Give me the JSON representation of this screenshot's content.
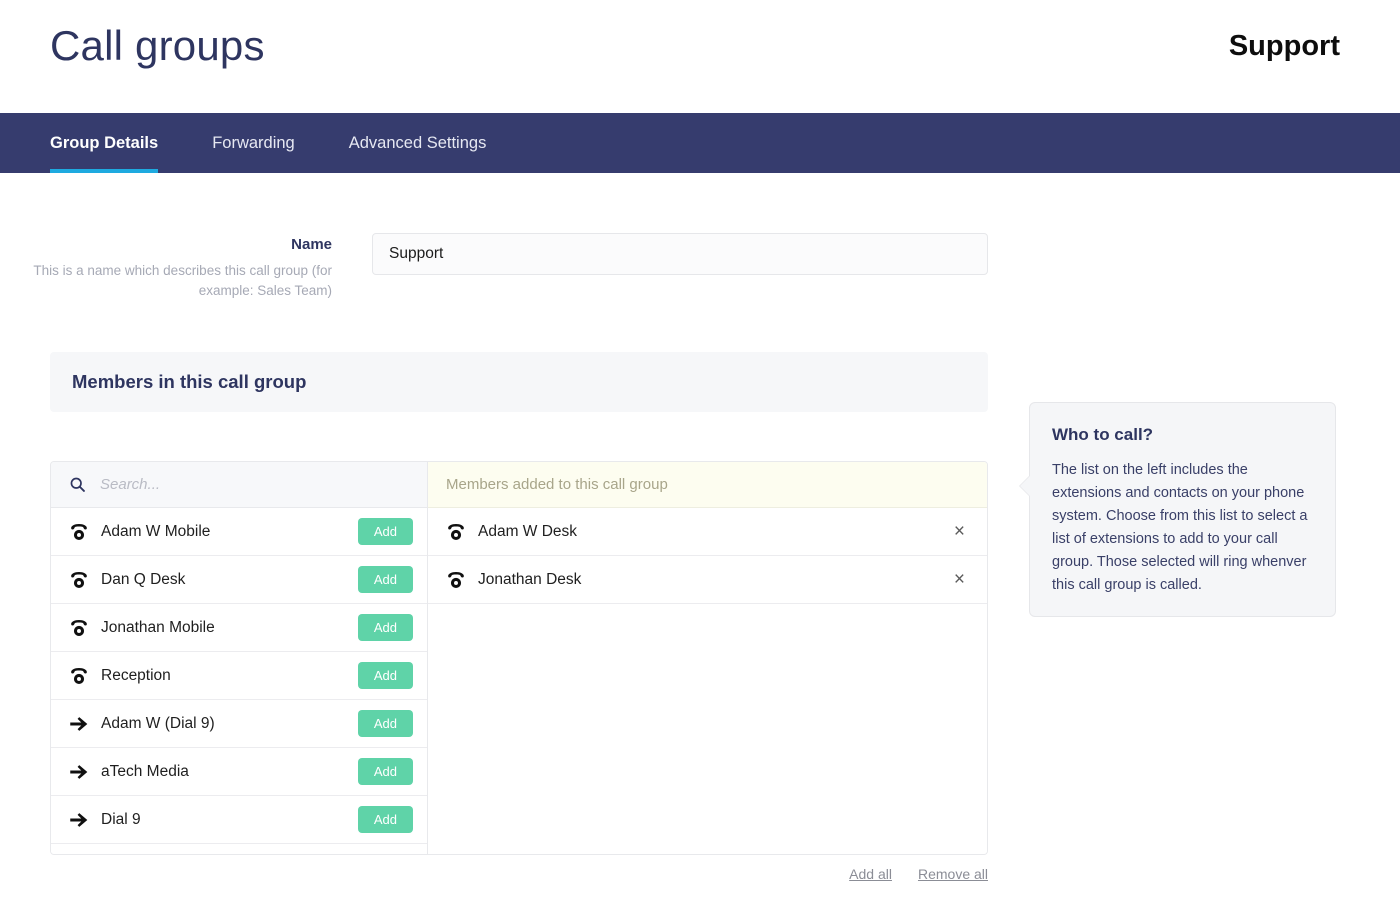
{
  "header": {
    "page_title": "Call groups",
    "account_title": "Support"
  },
  "nav": {
    "tabs": [
      {
        "label": "Group Details",
        "active": true
      },
      {
        "label": "Forwarding",
        "active": false
      },
      {
        "label": "Advanced Settings",
        "active": false
      }
    ]
  },
  "form": {
    "name_label": "Name",
    "name_help": "This is a name which describes this call group (for example: Sales Team)",
    "name_value": "Support",
    "name_placeholder": ""
  },
  "members_panel": {
    "title": "Members in this call group"
  },
  "dual_list": {
    "search": {
      "placeholder": "Search...",
      "value": "",
      "icon": "search-icon"
    },
    "added_header": "Members added to this call group",
    "add_button_label": "Add",
    "remove_button_label": "×",
    "available": [
      {
        "label": "Adam W Mobile",
        "icon": "phone-icon"
      },
      {
        "label": "Dan Q Desk",
        "icon": "phone-icon"
      },
      {
        "label": "Jonathan Mobile",
        "icon": "phone-icon"
      },
      {
        "label": "Reception",
        "icon": "phone-icon"
      },
      {
        "label": "Adam W (Dial 9)",
        "icon": "arrow-right-icon"
      },
      {
        "label": "aTech Media",
        "icon": "arrow-right-icon"
      },
      {
        "label": "Dial 9",
        "icon": "arrow-right-icon"
      }
    ],
    "added": [
      {
        "label": "Adam W Desk",
        "icon": "phone-icon"
      },
      {
        "label": "Jonathan Desk",
        "icon": "phone-icon"
      }
    ],
    "actions": {
      "add_all": "Add all",
      "remove_all": "Remove all"
    }
  },
  "callout": {
    "title": "Who to call?",
    "body": "The list on the left includes the extensions and contacts on your phone system. Choose from this list to select a list of extensions to add to your call group. Those selected will ring whenver this call group is called."
  },
  "colors": {
    "navbar": "#363c6e",
    "accent_underline": "#1eaae0",
    "add_button": "#5fd3a8",
    "title_navy": "#2e3560",
    "added_header_bg": "#fdfdf0"
  }
}
